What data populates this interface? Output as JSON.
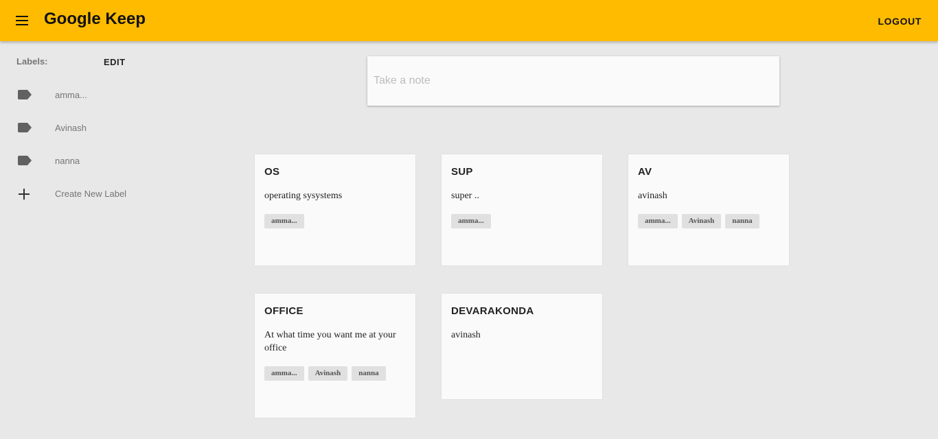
{
  "app": {
    "title": "Google Keep",
    "logout_label": "LOGOUT"
  },
  "sidebar": {
    "heading": "Labels:",
    "edit_label": "EDIT",
    "labels": [
      "amma...",
      "Avinash",
      "nanna"
    ],
    "create_label": "Create New Label"
  },
  "note_input": {
    "placeholder": "Take a note",
    "value": ""
  },
  "notes": [
    {
      "title": "OS",
      "body": "operating sysystems",
      "labels": [
        "amma..."
      ]
    },
    {
      "title": "SUP",
      "body": "super ..",
      "labels": [
        "amma..."
      ]
    },
    {
      "title": "AV",
      "body": "avinash",
      "labels": [
        "amma...",
        "Avinash",
        "nanna"
      ]
    },
    {
      "title": "OFFICE",
      "body": "At what time you want me at your office",
      "labels": [
        "amma...",
        "Avinash",
        "nanna"
      ]
    },
    {
      "title": "DEVARAKONDA",
      "body": "avinash",
      "labels": []
    }
  ],
  "icons": {
    "menu": "menu-icon",
    "label": "label-icon",
    "add": "plus-icon"
  },
  "colors": {
    "appbar": "#ffbb00",
    "background": "#e8e8e8",
    "card": "#fafafa",
    "chip": "#e0e0e0"
  }
}
